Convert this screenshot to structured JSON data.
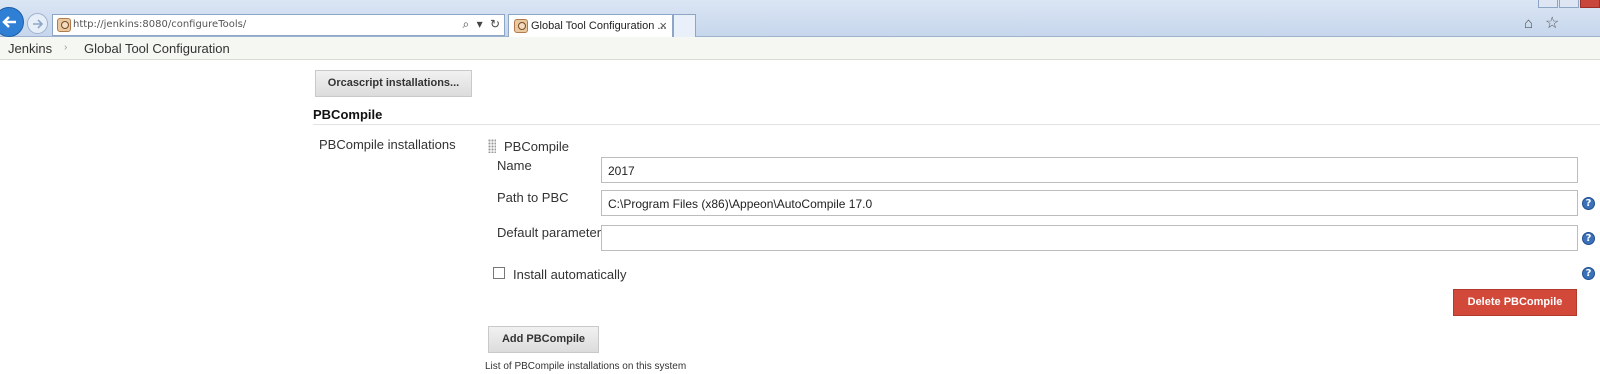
{
  "browser": {
    "url": "http://jenkins:8080/configureTools/",
    "tab_title": "Global Tool Configuration ...",
    "tab_close": "×",
    "addr_icons": {
      "search": "⌕",
      "dropdown": "▾",
      "refresh": "↻"
    },
    "home_glyph": "⌂",
    "star_glyph": "☆",
    "accent": "#2f7fd4"
  },
  "breadcrumb": {
    "items": [
      "Jenkins",
      "Global Tool Configuration"
    ],
    "separator": "›"
  },
  "orcascript": {
    "button_label": "Orcascript installations..."
  },
  "pbcompile": {
    "section_title": "PBCompile",
    "installations_label": "PBCompile installations",
    "item_title": "PBCompile",
    "name_label": "Name",
    "name_value": "2017",
    "path_label": "Path to PBC",
    "path_value": "C:\\Program Files (x86)\\Appeon\\AutoCompile 17.0",
    "default_params_label": "Default parameters",
    "default_params_value": "",
    "install_auto_label": "Install automatically",
    "install_auto_checked": false,
    "delete_button": "Delete PBCompile",
    "add_button": "Add PBCompile",
    "description": "List of PBCompile installations on this system",
    "help_glyph": "?",
    "danger_color": "#d24939"
  }
}
